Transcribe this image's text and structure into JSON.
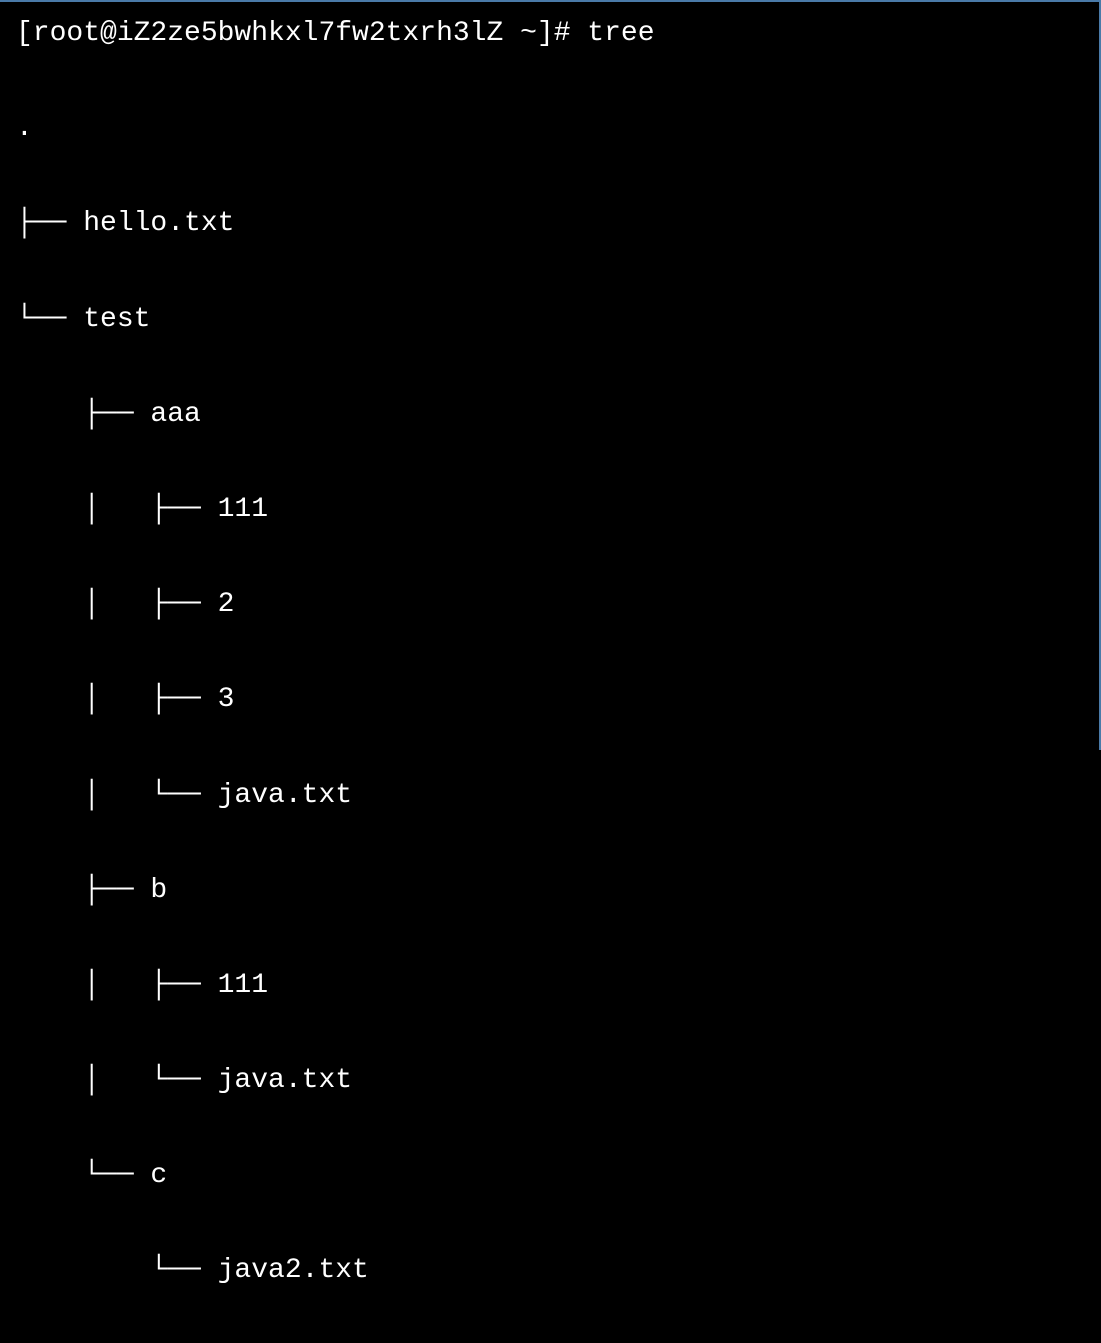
{
  "terminal": {
    "prompt": "[root@iZ2ze5bwhkxl7fw2txrh3lZ ~]# ",
    "command": "tree",
    "tree_lines": [
      ".",
      "├── hello.txt",
      "└── test",
      "    ├── aaa",
      "    │   ├── 111",
      "    │   ├── 2",
      "    │   ├── 3",
      "    │   └── java.txt",
      "    ├── b",
      "    │   ├── 111",
      "    │   └── java.txt",
      "    └── c",
      "        └── java2.txt"
    ]
  }
}
